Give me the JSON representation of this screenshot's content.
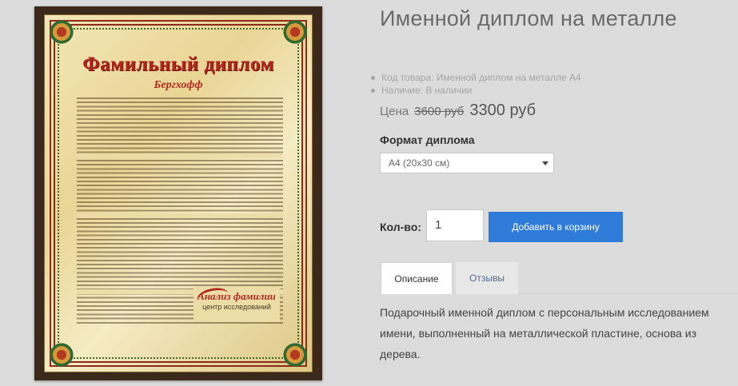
{
  "product": {
    "title": "Именной диплом на металле",
    "sku": "Код товара: Именной диплом на металле А4",
    "availability": "Наличие: В наличии"
  },
  "price": {
    "label": "Цена",
    "old": "3600 руб",
    "new": "3300 руб"
  },
  "format": {
    "label": "Формат диплома",
    "selected": "А4 (20х30 см)"
  },
  "quantity": {
    "label": "Кол-во:",
    "value": "1"
  },
  "cart": {
    "button_label": "Добавить в корзину"
  },
  "tabs": [
    {
      "label": "Описание",
      "active": true
    },
    {
      "label": "Отзывы",
      "active": false
    }
  ],
  "description": "Подарочный именной диплом с персональным исследованием имени, выполненный на металлической пластине, основа из дерева.",
  "image": {
    "heading": "Фамильный диплом",
    "surname": "Бергхофф",
    "stamp_title": "Анализ фамилии",
    "stamp_subtitle": "центр исследований"
  },
  "colors": {
    "accent_button": "#2f7bd9",
    "tab_inactive_text": "#4f6d8f",
    "diploma_red": "#b3261e"
  }
}
